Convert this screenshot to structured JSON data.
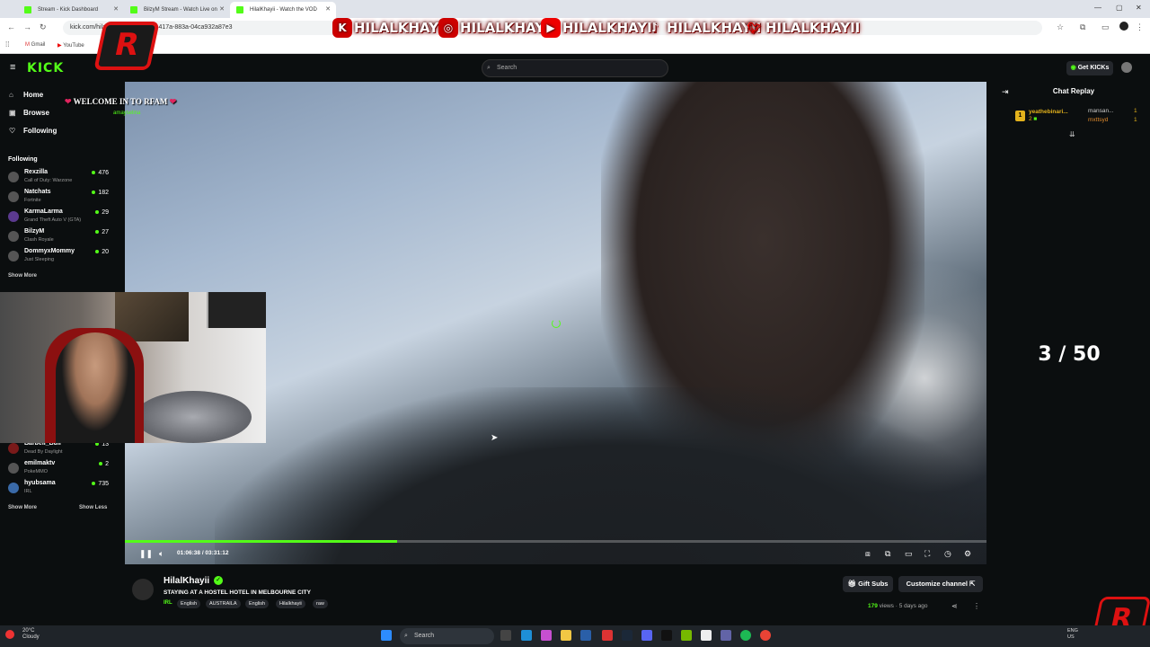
{
  "browser": {
    "tabs": [
      {
        "label": "Stream - Kick Dashboard",
        "active": false
      },
      {
        "label": "BilzyM Stream - Watch Live on",
        "active": false
      },
      {
        "label": "HilalKhayii - Watch the VOD",
        "active": true
      }
    ],
    "url": "kick.com/hilalkh...d4da28-2a05-417a-883a-04ca932a87e3",
    "bookmarks": [
      "Gmail",
      "YouTube"
    ]
  },
  "header": {
    "logo": "KICK",
    "search_placeholder": "Search",
    "get_kicks": "Get KICKs"
  },
  "sidebar": {
    "nav": [
      {
        "label": "Home",
        "icon": "home-icon"
      },
      {
        "label": "Browse",
        "icon": "browse-icon"
      },
      {
        "label": "Following",
        "icon": "heart-icon"
      }
    ],
    "following_title": "Following",
    "following": [
      {
        "name": "Rexzilla",
        "game": "Call of Duty: Warzone",
        "viewers": "476"
      },
      {
        "name": "Natchats",
        "game": "Fortnite",
        "viewers": "182"
      },
      {
        "name": "KarmaLarma",
        "game": "Grand Theft Auto V (GTA)",
        "viewers": "29"
      },
      {
        "name": "BilzyM",
        "game": "Clash Royale",
        "viewers": "27"
      },
      {
        "name": "DommyxMommy",
        "game": "Just Sleeping",
        "viewers": "20"
      }
    ],
    "show_more": "Show More",
    "recommended": [
      {
        "name": "Barbell_Bull",
        "game": "Dead By Daylight",
        "viewers": "13"
      },
      {
        "name": "emilmaktv",
        "game": "PokeMMO",
        "viewers": "2"
      },
      {
        "name": "hyubsama",
        "game": "IRL",
        "viewers": "735"
      }
    ],
    "show_more_2": "Show More",
    "show_less": "Show Less"
  },
  "player": {
    "time": "01:06:38 / 03:31:12",
    "progress": 0.3155
  },
  "chat": {
    "title": "Chat Replay",
    "entries": [
      {
        "user": "yeathebinari...",
        "badge": "1"
      },
      {
        "user": "mansan...",
        "count": "1"
      },
      {
        "user": "mxttsyd",
        "count": "1"
      }
    ]
  },
  "overlay": {
    "social": [
      "HILALKHAYII",
      "HILALKHAYII",
      "HILALKHAYII",
      "HILALKHAYII",
      "HILALKHAYII"
    ],
    "welcome": "WELCOME IN TO RFAM",
    "welcome_sub": "amayselina",
    "counter": "3 / 50",
    "logo_letter": "R"
  },
  "stream_info": {
    "name": "HilalKhayii",
    "title": "STAYING AT A HOSTEL HOTEL IN MELBOURNE CITY",
    "category": "IRL",
    "tags": [
      "English",
      "AUSTRAILA",
      "English",
      "Hilalkhayii",
      "raw"
    ],
    "gift_subs": "Gift Subs",
    "customize": "Customize channel",
    "views_count": "179",
    "views_label": "views",
    "age": "5 days ago"
  },
  "taskbar": {
    "temp": "20°C",
    "weather": "Cloudy",
    "search": "Search",
    "lang": "ENG",
    "region": "US"
  },
  "colors": {
    "accent": "#53fc18",
    "bg": "#0b0e0f",
    "brand_red": "#dd1111"
  }
}
